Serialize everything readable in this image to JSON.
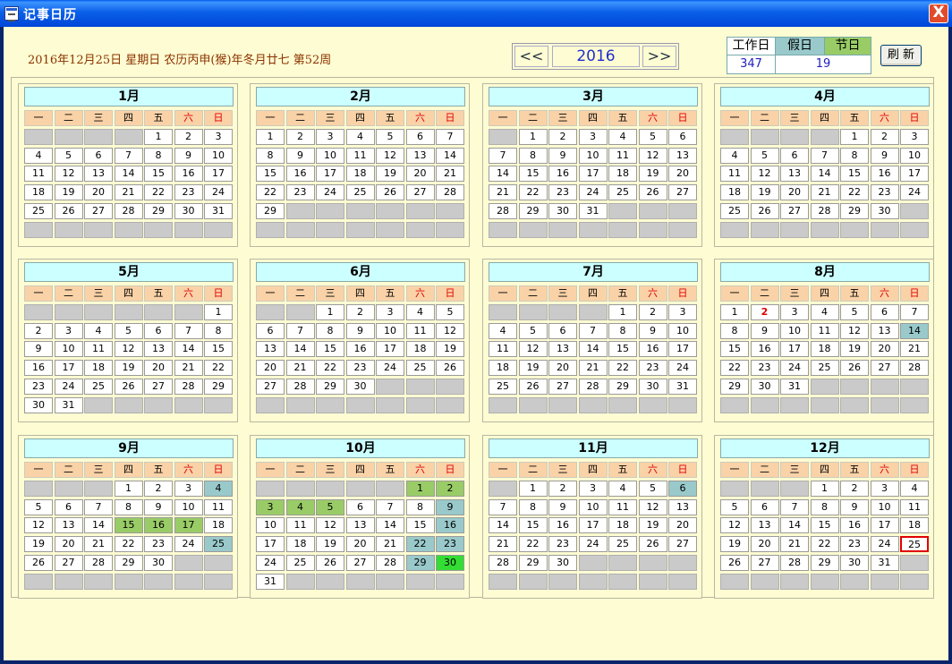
{
  "window": {
    "title": "记事日历",
    "close_label": "X"
  },
  "header": {
    "date_line": "2016年12月25日  星期日  农历丙申(猴)年冬月廿七  第52周",
    "prev_label": "<<",
    "next_label": ">>",
    "year": "2016",
    "stats": {
      "work_label": "工作日",
      "holiday_label": "假日",
      "festival_label": "节日",
      "work_value": "347",
      "holiday_value": "19"
    },
    "refresh_label": "刷 新"
  },
  "weekdays": [
    "一",
    "二",
    "三",
    "四",
    "五",
    "六",
    "日"
  ],
  "colors": {
    "holiday": "#99c9cb",
    "festival": "#99cc66",
    "today_border": "#e00000"
  },
  "months": [
    {
      "name": "1月",
      "start": 4,
      "days": 31,
      "holidays": [],
      "festivals": [],
      "red": []
    },
    {
      "name": "2月",
      "start": 0,
      "days": 29,
      "holidays": [],
      "festivals": [],
      "red": []
    },
    {
      "name": "3月",
      "start": 1,
      "days": 31,
      "holidays": [],
      "festivals": [],
      "red": []
    },
    {
      "name": "4月",
      "start": 4,
      "days": 30,
      "holidays": [],
      "festivals": [],
      "red": []
    },
    {
      "name": "5月",
      "start": 6,
      "days": 31,
      "holidays": [],
      "festivals": [],
      "red": []
    },
    {
      "name": "6月",
      "start": 2,
      "days": 30,
      "holidays": [],
      "festivals": [],
      "red": []
    },
    {
      "name": "7月",
      "start": 4,
      "days": 31,
      "holidays": [],
      "festivals": [],
      "red": []
    },
    {
      "name": "8月",
      "start": 0,
      "days": 31,
      "holidays": [
        14
      ],
      "festivals": [],
      "red": [
        2
      ]
    },
    {
      "name": "9月",
      "start": 3,
      "days": 30,
      "holidays": [
        4,
        25
      ],
      "festivals": [
        15,
        16,
        17
      ],
      "red": []
    },
    {
      "name": "10月",
      "start": 5,
      "days": 31,
      "holidays": [
        9,
        16,
        22,
        23,
        29
      ],
      "festivals": [
        1,
        2,
        3,
        4,
        5
      ],
      "bright": [
        30
      ],
      "red": []
    },
    {
      "name": "11月",
      "start": 1,
      "days": 30,
      "holidays": [
        6
      ],
      "festivals": [],
      "red": []
    },
    {
      "name": "12月",
      "start": 3,
      "days": 31,
      "holidays": [],
      "festivals": [],
      "red": [],
      "today": 25
    }
  ]
}
